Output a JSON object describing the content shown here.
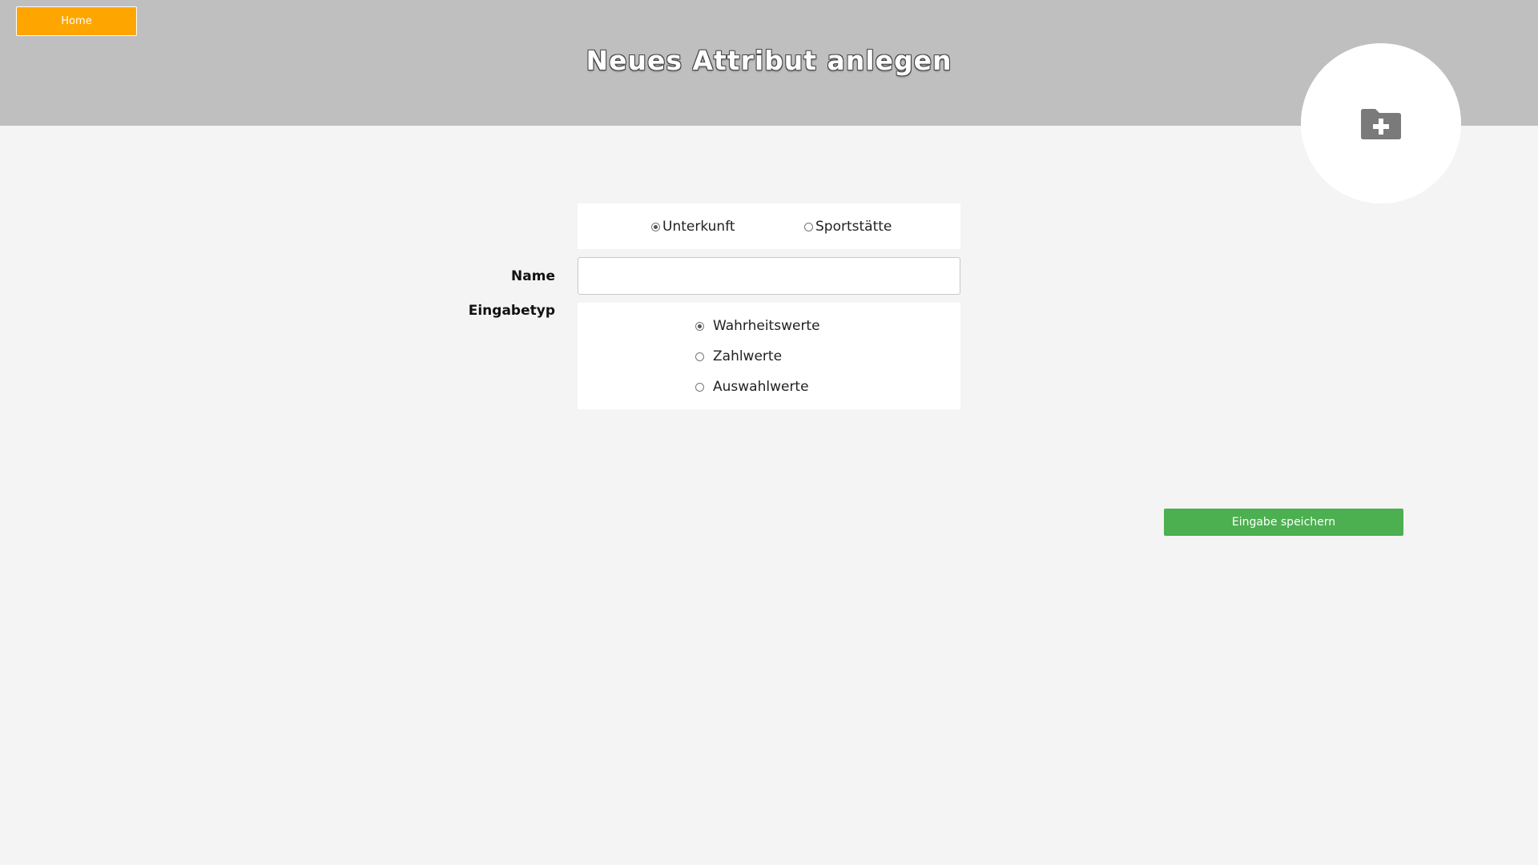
{
  "header": {
    "home_label": "Home",
    "title": "Neues Attribut anlegen",
    "icon": "folder-plus-icon",
    "bg_color": "#bfbfbf",
    "home_color": "#ffa500"
  },
  "form": {
    "category": {
      "options": [
        {
          "label": "Unterkunft",
          "checked": true
        },
        {
          "label": "Sportstätte",
          "checked": false
        }
      ]
    },
    "name": {
      "label": "Name",
      "value": "",
      "placeholder": ""
    },
    "input_type": {
      "label": "Eingabetyp",
      "options": [
        {
          "label": "Wahrheitswerte",
          "checked": true
        },
        {
          "label": "Zahlwerte",
          "checked": false
        },
        {
          "label": "Auswahlwerte",
          "checked": false
        }
      ]
    },
    "save_label": "Eingabe speichern",
    "save_color": "#4caf50"
  }
}
